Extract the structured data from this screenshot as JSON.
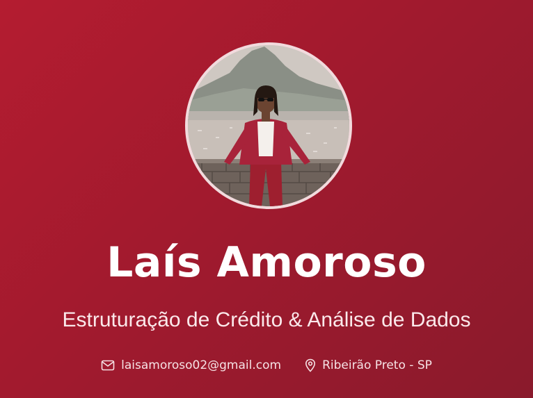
{
  "profile": {
    "name": "Laís Amoroso",
    "headline": "Estruturação de Crédito & Análise de Dados",
    "email": "laisamoroso02@gmail.com",
    "location": "Ribeirão Preto - SP",
    "photo_alt": "Laís Amoroso",
    "icons": {
      "email": "mail-icon",
      "location": "map-pin-icon"
    }
  },
  "colors": {
    "background_start": "#b41c30",
    "background_end": "#8a1a2c",
    "avatar_border": "#f2dadd",
    "text": "#ffffff"
  }
}
